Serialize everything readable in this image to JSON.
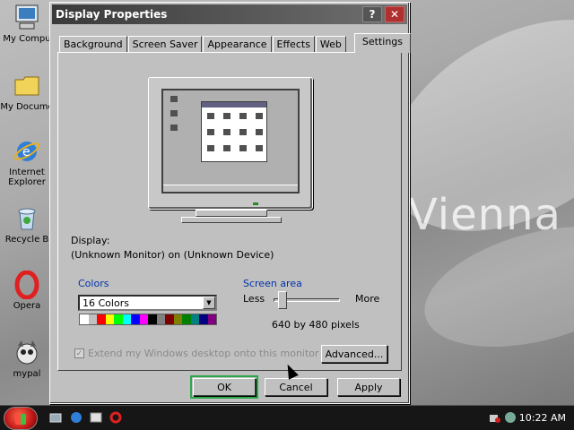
{
  "desktop": {
    "wallpaper_text": "Vienna",
    "icons": [
      {
        "label": "My Compu",
        "icon": "computer-icon"
      },
      {
        "label": "My Docume",
        "icon": "folder-icon"
      },
      {
        "label": "Internet",
        "label2": "Explorer",
        "icon": "ie-icon"
      },
      {
        "label": "Recycle B",
        "icon": "recycle-bin-icon"
      },
      {
        "label": "Opera",
        "icon": "opera-icon"
      },
      {
        "label": "mypal",
        "icon": "mypal-icon"
      }
    ]
  },
  "window": {
    "title": "Display Properties",
    "help_label": "?",
    "close_label": "✕"
  },
  "tabs": [
    {
      "label": "Background",
      "active": false
    },
    {
      "label": "Screen Saver",
      "active": false
    },
    {
      "label": "Appearance",
      "active": false
    },
    {
      "label": "Effects",
      "active": false
    },
    {
      "label": "Web",
      "active": false
    },
    {
      "label": "Settings",
      "active": true
    }
  ],
  "settings": {
    "display_label": "Display:",
    "display_value": "(Unknown Monitor) on (Unknown Device)",
    "colors_label": "Colors",
    "colors_value": "16 Colors",
    "palette": [
      "#ffffff",
      "#c0c0c0",
      "#ff0000",
      "#ffff00",
      "#00ff00",
      "#00ffff",
      "#0000ff",
      "#ff00ff",
      "#000000",
      "#808080",
      "#800000",
      "#808000",
      "#008000",
      "#008080",
      "#000080",
      "#800080"
    ],
    "screen_area_label": "Screen area",
    "less_label": "Less",
    "more_label": "More",
    "resolution_text": "640 by 480 pixels",
    "extend_label": "Extend my Windows desktop onto this monitor",
    "extend_checked": true,
    "advanced_label": "Advanced..."
  },
  "buttons": {
    "ok": "OK",
    "cancel": "Cancel",
    "apply": "Apply"
  },
  "taskbar": {
    "clock": "10:22 AM"
  }
}
